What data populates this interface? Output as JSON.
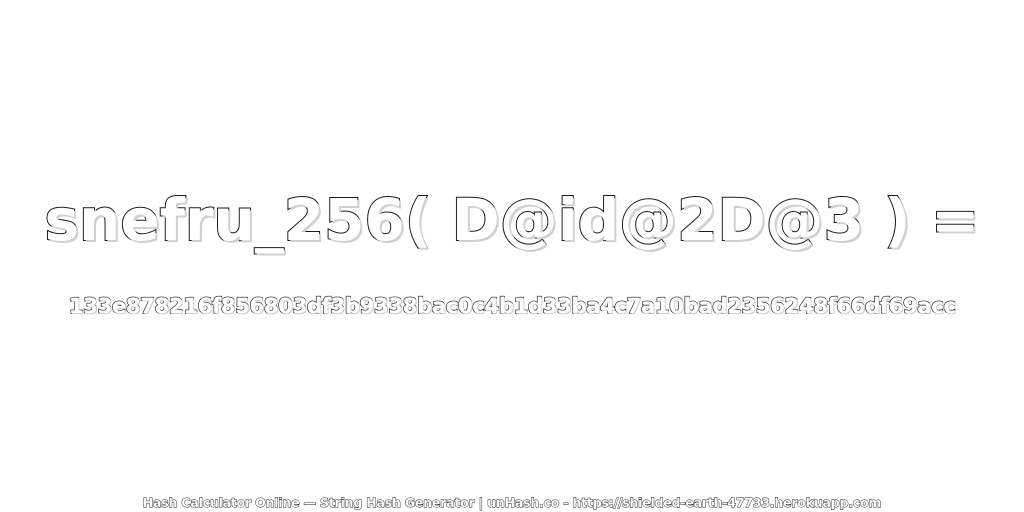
{
  "expression": "snefru_256( D@id@2D@3 ) =",
  "hash_value": "133e878216f856803df3b9338bac0c4b1d33ba4c7a10bad2356248f66df69acc",
  "footer": "Hash Calculator Online — String Hash Generator | unHash.co - https://shielded-earth-47733.herokuapp.com",
  "colors": {
    "background": "#ffffff",
    "stroke": "#1a1a1a",
    "fill": "#ffffff"
  }
}
